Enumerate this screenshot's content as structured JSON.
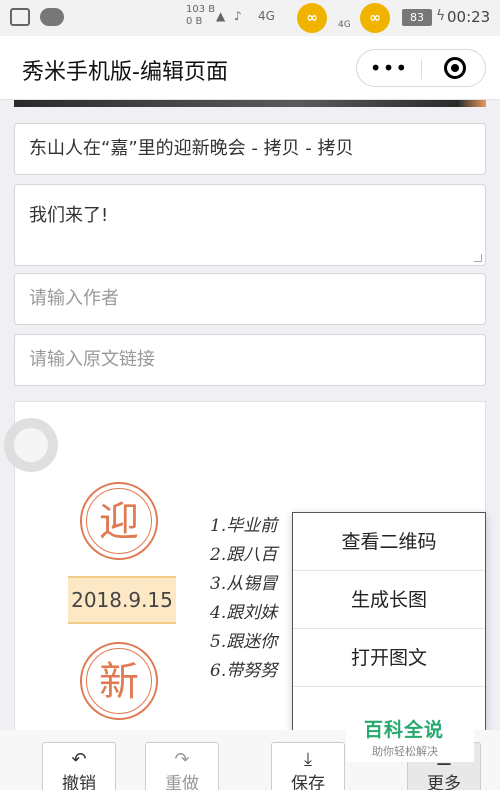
{
  "status_bar": {
    "net_up": "103 B",
    "net_down": "0 B",
    "signal_1": "4G",
    "signal_2": "4G",
    "battery": "83",
    "time": "00:23"
  },
  "header": {
    "title": "秀米手机版-编辑页面",
    "more_label": "•••"
  },
  "form": {
    "title_value": "东山人在“嘉”里的迎新晚会 - 拷贝 - 拷贝",
    "summary_value": "我们来了!",
    "author_placeholder": "请输入作者",
    "link_placeholder": "请输入原文链接"
  },
  "preview": {
    "stamp_top": "迎",
    "date": "2018.9.15",
    "stamp_bottom": "新",
    "handwritten_lines": [
      "1.毕业前",
      "2.跟八百",
      "3.从锡冒",
      "4.跟刘妹",
      "5.跟迷你",
      "6.带努努"
    ]
  },
  "menu": {
    "items": [
      "查看二维码",
      "生成长图",
      "打开图文"
    ]
  },
  "toolbar": {
    "undo": "撤销",
    "redo": "重做",
    "save": "保存",
    "more": "更多"
  },
  "watermark": {
    "title": "百科全说",
    "subtitle": "助你轻松解决"
  },
  "icons": {
    "undo": "undo-arrow-icon",
    "redo": "redo-arrow-icon",
    "save": "download-icon",
    "more": "list-icon"
  }
}
